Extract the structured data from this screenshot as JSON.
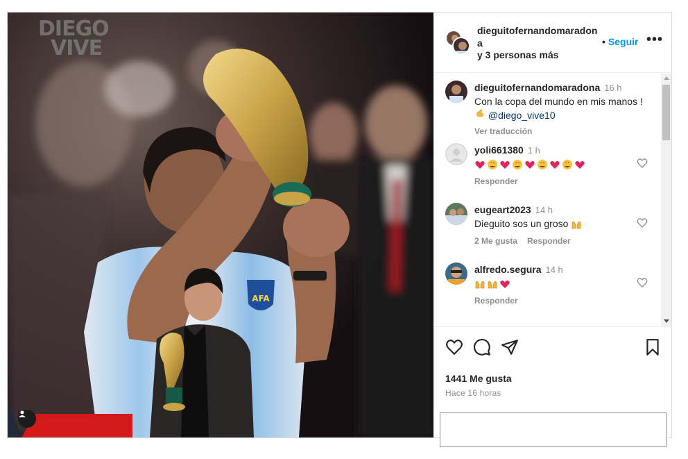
{
  "post": {
    "watermark_line1": "DIEGO",
    "watermark_line2": "VIVE"
  },
  "header": {
    "username": "dieguitofernandomaradona",
    "others": "y 3 personas más",
    "follow_separator": "•",
    "follow_label": "Seguir",
    "more_label": "•••"
  },
  "caption": {
    "username": "dieguitofernandomaradona",
    "time": "16 h",
    "line1": "Con la copa del mundo en mis manos !",
    "mention": "@diego_vive10",
    "translate": "Ver traducción"
  },
  "comments": [
    {
      "username": "yoli661380",
      "time": "1 h",
      "reply": "Responder"
    },
    {
      "username": "eugeart2023",
      "time": "14 h",
      "text": "Dieguito sos un groso",
      "likes": "2 Me gusta",
      "reply": "Responder"
    },
    {
      "username": "alfredo.segura",
      "time": "14 h",
      "reply": "Responder"
    }
  ],
  "footer": {
    "likes": "1441 Me gusta",
    "ago": "Hace 16 horas",
    "comment_placeholder": ""
  },
  "colors": {
    "link": "#0095f6",
    "mention": "#00376b",
    "muted": "#8e8e8e",
    "heart_red": "#e0245e"
  },
  "icons": [
    "user-tag-icon",
    "more-options-icon",
    "heart-icon",
    "comment-icon",
    "share-icon",
    "bookmark-icon",
    "muscle-emoji-icon",
    "heart-emoji-icon",
    "star-eyes-emoji-icon",
    "raised-hands-emoji-icon"
  ]
}
